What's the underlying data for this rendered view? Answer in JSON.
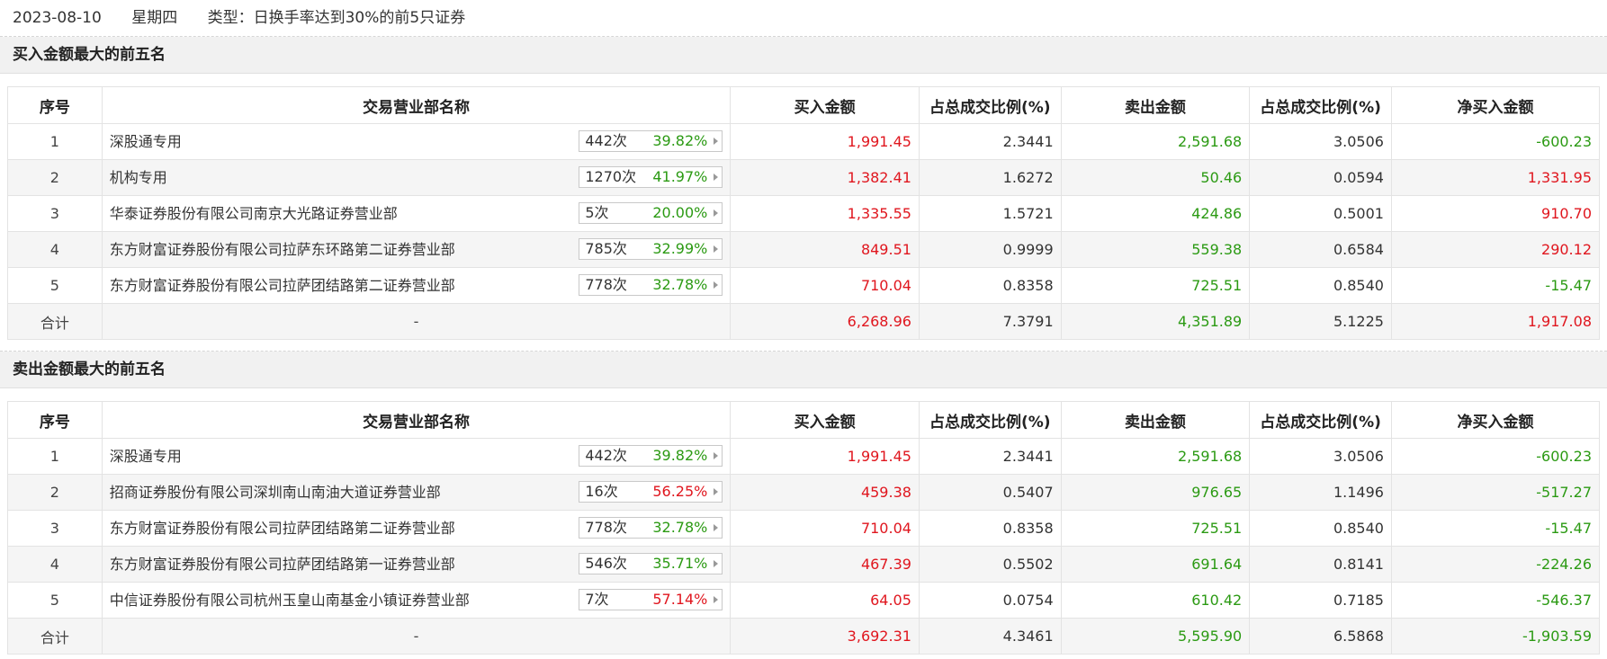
{
  "header": {
    "date": "2023-08-10",
    "weekday": "星期四",
    "type": "类型：日换手率达到30%的前5只证券"
  },
  "columns": [
    "序号",
    "交易营业部名称",
    "买入金额",
    "占总成交比例(%)",
    "卖出金额",
    "占总成交比例(%)",
    "净买入金额"
  ],
  "colors": {
    "up": "#e0161e",
    "down": "#2b9a13"
  },
  "buy_section": {
    "title": "买入金额最大的前五名",
    "rows": [
      {
        "idx": "1",
        "name": "深股通专用",
        "count": "442次",
        "pct": "39.82%",
        "pct_dir": "green",
        "buy": "1,991.45",
        "buy_ratio": "2.3441",
        "sell": "2,591.68",
        "sell_ratio": "3.0506",
        "net": "-600.23",
        "net_dir": "green"
      },
      {
        "idx": "2",
        "name": "机构专用",
        "count": "1270次",
        "pct": "41.97%",
        "pct_dir": "green",
        "buy": "1,382.41",
        "buy_ratio": "1.6272",
        "sell": "50.46",
        "sell_ratio": "0.0594",
        "net": "1,331.95",
        "net_dir": "red"
      },
      {
        "idx": "3",
        "name": "华泰证券股份有限公司南京大光路证券营业部",
        "count": "5次",
        "pct": "20.00%",
        "pct_dir": "green",
        "buy": "1,335.55",
        "buy_ratio": "1.5721",
        "sell": "424.86",
        "sell_ratio": "0.5001",
        "net": "910.70",
        "net_dir": "red"
      },
      {
        "idx": "4",
        "name": "东方财富证券股份有限公司拉萨东环路第二证券营业部",
        "count": "785次",
        "pct": "32.99%",
        "pct_dir": "green",
        "buy": "849.51",
        "buy_ratio": "0.9999",
        "sell": "559.38",
        "sell_ratio": "0.6584",
        "net": "290.12",
        "net_dir": "red"
      },
      {
        "idx": "5",
        "name": "东方财富证券股份有限公司拉萨团结路第二证券营业部",
        "count": "778次",
        "pct": "32.78%",
        "pct_dir": "green",
        "buy": "710.04",
        "buy_ratio": "0.8358",
        "sell": "725.51",
        "sell_ratio": "0.8540",
        "net": "-15.47",
        "net_dir": "green"
      }
    ],
    "total": {
      "label": "合计",
      "name": "-",
      "buy": "6,268.96",
      "buy_ratio": "7.3791",
      "sell": "4,351.89",
      "sell_ratio": "5.1225",
      "net": "1,917.08",
      "net_dir": "red"
    }
  },
  "sell_section": {
    "title": "卖出金额最大的前五名",
    "rows": [
      {
        "idx": "1",
        "name": "深股通专用",
        "count": "442次",
        "pct": "39.82%",
        "pct_dir": "green",
        "buy": "1,991.45",
        "buy_ratio": "2.3441",
        "sell": "2,591.68",
        "sell_ratio": "3.0506",
        "net": "-600.23",
        "net_dir": "green"
      },
      {
        "idx": "2",
        "name": "招商证券股份有限公司深圳南山南油大道证券营业部",
        "count": "16次",
        "pct": "56.25%",
        "pct_dir": "red",
        "buy": "459.38",
        "buy_ratio": "0.5407",
        "sell": "976.65",
        "sell_ratio": "1.1496",
        "net": "-517.27",
        "net_dir": "green"
      },
      {
        "idx": "3",
        "name": "东方财富证券股份有限公司拉萨团结路第二证券营业部",
        "count": "778次",
        "pct": "32.78%",
        "pct_dir": "green",
        "buy": "710.04",
        "buy_ratio": "0.8358",
        "sell": "725.51",
        "sell_ratio": "0.8540",
        "net": "-15.47",
        "net_dir": "green"
      },
      {
        "idx": "4",
        "name": "东方财富证券股份有限公司拉萨团结路第一证券营业部",
        "count": "546次",
        "pct": "35.71%",
        "pct_dir": "green",
        "buy": "467.39",
        "buy_ratio": "0.5502",
        "sell": "691.64",
        "sell_ratio": "0.8141",
        "net": "-224.26",
        "net_dir": "green"
      },
      {
        "idx": "5",
        "name": "中信证券股份有限公司杭州玉皇山南基金小镇证券营业部",
        "count": "7次",
        "pct": "57.14%",
        "pct_dir": "red",
        "buy": "64.05",
        "buy_ratio": "0.0754",
        "sell": "610.42",
        "sell_ratio": "0.7185",
        "net": "-546.37",
        "net_dir": "green"
      }
    ],
    "total": {
      "label": "合计",
      "name": "-",
      "buy": "3,692.31",
      "buy_ratio": "4.3461",
      "sell": "5,595.90",
      "sell_ratio": "6.5868",
      "net": "-1,903.59",
      "net_dir": "green"
    }
  }
}
